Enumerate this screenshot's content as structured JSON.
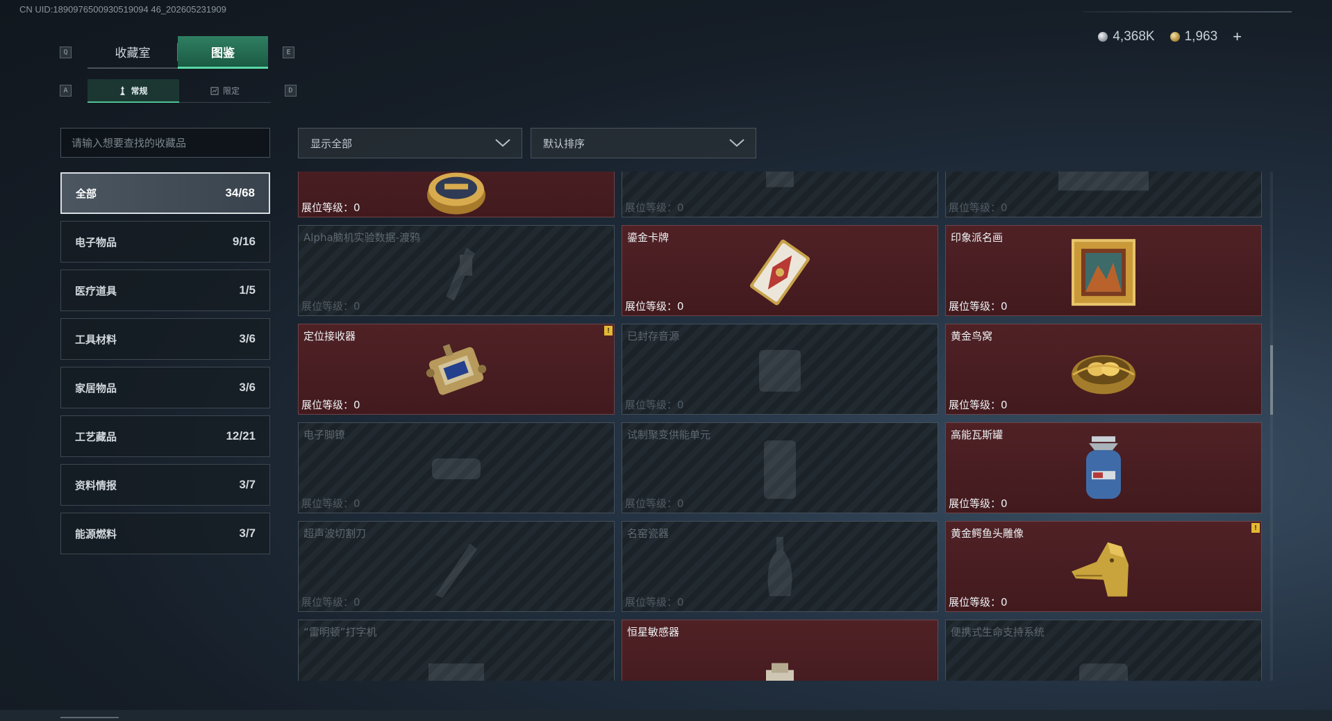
{
  "header": {
    "uid": "CN UID:1890976500930519094 46_202605231909",
    "currencies": [
      {
        "type": "silver",
        "value": "4,368K"
      },
      {
        "type": "gold",
        "value": "1,963"
      }
    ],
    "add_label": "+"
  },
  "keys": {
    "prev_tab": "Q",
    "next_tab": "E",
    "prev_sub": "A",
    "next_sub": "D"
  },
  "main_tabs": [
    {
      "label": "收藏室",
      "active": false
    },
    {
      "label": "图鉴",
      "active": true
    }
  ],
  "sub_tabs": [
    {
      "label": "常规",
      "active": true
    },
    {
      "label": "限定",
      "active": false
    }
  ],
  "search": {
    "placeholder": "请输入想要查找的收藏品",
    "value": ""
  },
  "filters": {
    "show": "显示全部",
    "sort": "默认排序"
  },
  "categories": [
    {
      "label": "全部",
      "count": "34/68",
      "active": true
    },
    {
      "label": "电子物品",
      "count": "9/16"
    },
    {
      "label": "医疗道具",
      "count": "1/5"
    },
    {
      "label": "工具材料",
      "count": "3/6"
    },
    {
      "label": "家居物品",
      "count": "3/6"
    },
    {
      "label": "工艺藏品",
      "count": "12/21"
    },
    {
      "label": "资料情报",
      "count": "3/7"
    },
    {
      "label": "能源燃料",
      "count": "3/7"
    }
  ],
  "items": [
    {
      "name": "",
      "level": "展位等级：0",
      "owned": true,
      "icon": "caviar-tin-icon"
    },
    {
      "name": "",
      "level": "展位等级：0",
      "owned": false,
      "icon": "unknown-item-icon"
    },
    {
      "name": "",
      "level": "展位等级：0",
      "owned": false,
      "icon": "unknown-item-icon"
    },
    {
      "name": "Alpha脑机实验数据-渡鸦",
      "level": "展位等级：0",
      "owned": false,
      "icon": "data-drive-icon"
    },
    {
      "name": "鎏金卡牌",
      "level": "展位等级：0",
      "owned": true,
      "icon": "gold-card-icon"
    },
    {
      "name": "印象派名画",
      "level": "展位等级：0",
      "owned": true,
      "icon": "framed-painting-icon"
    },
    {
      "name": "定位接收器",
      "level": "展位等级：0",
      "owned": true,
      "icon": "locator-receiver-icon",
      "badge": "!"
    },
    {
      "name": "已封存音源",
      "level": "展位等级：0",
      "owned": false,
      "icon": "sealed-audio-icon"
    },
    {
      "name": "黄金鸟窝",
      "level": "展位等级：0",
      "owned": true,
      "icon": "golden-nest-icon"
    },
    {
      "name": "电子脚镣",
      "level": "展位等级：0",
      "owned": false,
      "icon": "ankle-monitor-icon"
    },
    {
      "name": "试制聚变供能单元",
      "level": "展位等级：0",
      "owned": false,
      "icon": "fusion-cell-icon"
    },
    {
      "name": "高能瓦斯罐",
      "level": "展位等级：0",
      "owned": true,
      "icon": "gas-canister-icon"
    },
    {
      "name": "超声波切割刀",
      "level": "展位等级：0",
      "owned": false,
      "icon": "ultrasonic-cutter-icon"
    },
    {
      "name": "名窑瓷器",
      "level": "展位等级：0",
      "owned": false,
      "icon": "porcelain-vase-icon"
    },
    {
      "name": "黄金鳄鱼头雕像",
      "level": "展位等级：0",
      "owned": true,
      "icon": "gold-crocodile-head-icon",
      "badge": "!"
    },
    {
      "name": "“雷明顿”打字机",
      "level": "",
      "owned": false,
      "icon": "typewriter-icon"
    },
    {
      "name": "恒星敏感器",
      "level": "",
      "owned": true,
      "icon": "star-sensor-icon"
    },
    {
      "name": "便携式生命支持系统",
      "level": "",
      "owned": false,
      "icon": "life-support-icon"
    }
  ]
}
